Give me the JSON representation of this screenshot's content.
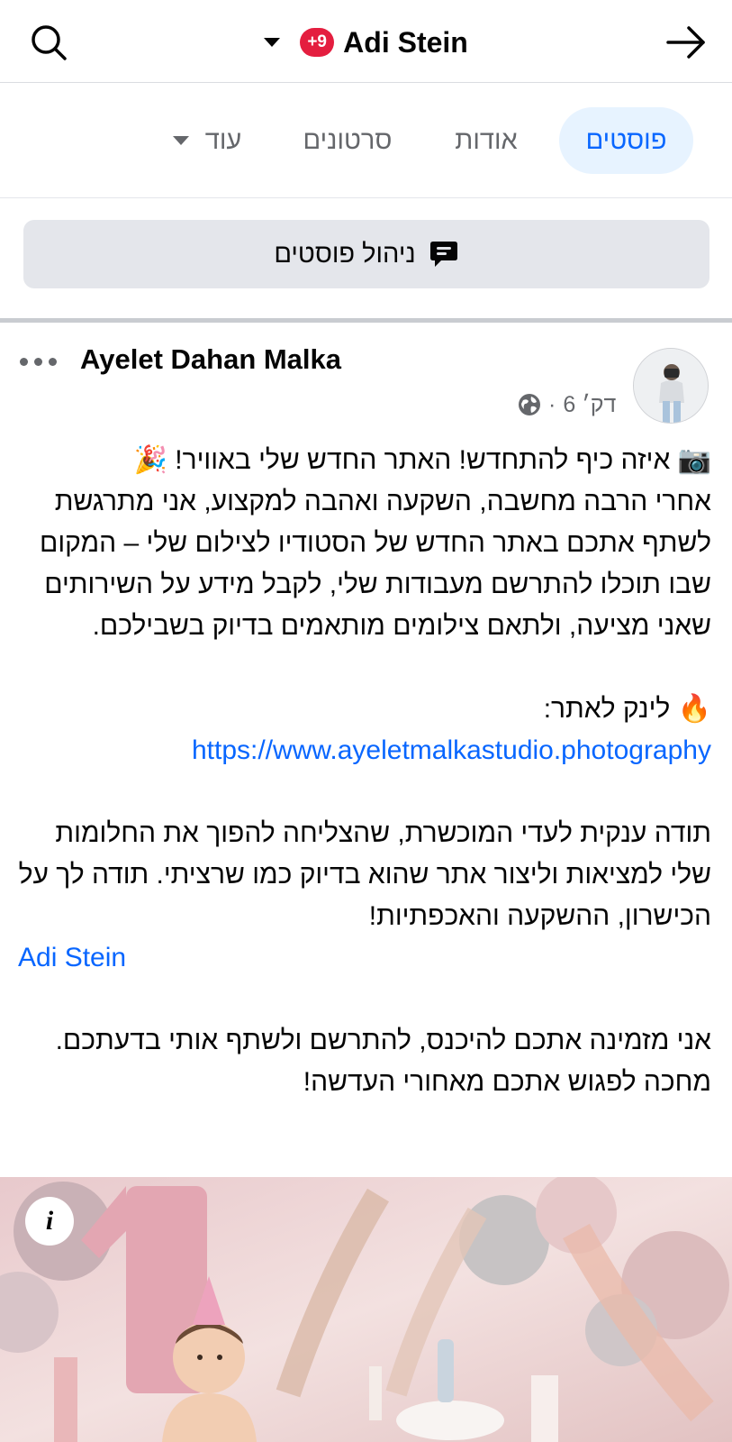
{
  "header": {
    "page_name": "Adi Stein",
    "notification_badge": "+9",
    "search_icon": "search-icon",
    "back_icon": "arrow-right-icon"
  },
  "tabs": [
    {
      "label": "פוסטים",
      "active": true
    },
    {
      "label": "אודות",
      "active": false
    },
    {
      "label": "סרטונים",
      "active": false
    },
    {
      "label": "עוד",
      "active": false
    }
  ],
  "manage_posts": {
    "label": "ניהול פוסטים",
    "icon": "message-bubble-icon"
  },
  "post": {
    "author": "Ayelet Dahan Malka",
    "time": "6 דק׳",
    "separator": "·",
    "privacy_icon": "globe-icon",
    "body": {
      "line1": "📷 איזה כיף להתחדש! האתר החדש שלי באוויר! 🎉",
      "paragraph1": "אחרי הרבה מחשבה, השקעה ואהבה למקצוע, אני מתרגשת לשתף אתכם באתר החדש של הסטודיו לצילום שלי – המקום שבו תוכלו להתרשם מעבודות שלי, לקבל מידע על השירותים שאני מציעה, ולתאם צילומים מותאמים בדיוק בשבילכם.",
      "link_label": "🔥 לינק לאתר:",
      "link_url": "https://www.ayeletmalkastudio.photography",
      "paragraph2": "תודה ענקית לעדי המוכשרת, שהצליחה להפוך את החלומות שלי למציאות וליצור אתר שהוא בדיוק כמו שרציתי. תודה לך על הכישרון, ההשקעה והאכפתיות!",
      "mention": "Adi Stein",
      "paragraph3": "אני מזמינה אתכם להיכנס, להתרשם ולשתף אותי בדעתכם. מחכה לפגוש אתכם מאחורי העדשה!"
    },
    "photo_info_icon": "info-icon",
    "photo_info_label": "i"
  },
  "colors": {
    "accent": "#0866ff",
    "active_tab_bg": "#e7f3ff",
    "badge": "#e41e3f",
    "secondary_text": "#65676b",
    "button_bg": "#e4e6eb"
  }
}
